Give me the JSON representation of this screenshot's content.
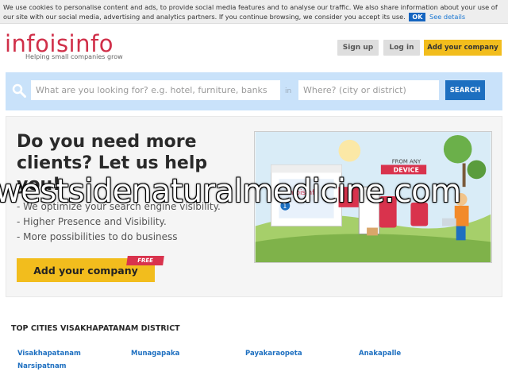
{
  "cookie_bar": {
    "text_before": "We use cookies to personalise content and ads, to provide social media features and to analyse our traffic. We also share information about your use of our site with our social media, advertising and analytics partners. If you continue browsing, we consider you accept its use.",
    "ok_label": "OK",
    "details_label": "See details"
  },
  "header": {
    "logo": "infoisinfo",
    "tagline": "Helping small companies grow",
    "signup_label": "Sign up",
    "login_label": "Log in",
    "add_company_label": "Add your company"
  },
  "search": {
    "what_placeholder": "What are you looking for? e.g. hotel, furniture, banks",
    "in_label": "in",
    "where_placeholder": "Where? (city or district)",
    "button_label": "SEARCH"
  },
  "promo": {
    "title": "Do you need more clients? Let us help you!",
    "bullets": [
      "- We optimize your search engine visibility.",
      "- Higher Presence and Visibility.",
      "- More possibilities to do business"
    ],
    "button_label": "Add your company",
    "badge": "FREE",
    "illustration": {
      "any_label": "FROM ANY",
      "device_label": "DEVICE",
      "card_title": "infoisinfo",
      "card_number": "1"
    }
  },
  "watermark": "westsidenaturalmedicine.com",
  "cities": {
    "title": "TOP CITIES VISAKHAPATANAM DISTRICT",
    "items": [
      "Visakhapatanam",
      "Munagapaka",
      "Payakaraopeta",
      "Anakapalle",
      "Narsipatnam"
    ]
  },
  "colors": {
    "brand_red": "#d02f49",
    "accent_yellow": "#f2bd1d",
    "link_blue": "#1d6fc0",
    "search_band": "#c9e2fa"
  }
}
